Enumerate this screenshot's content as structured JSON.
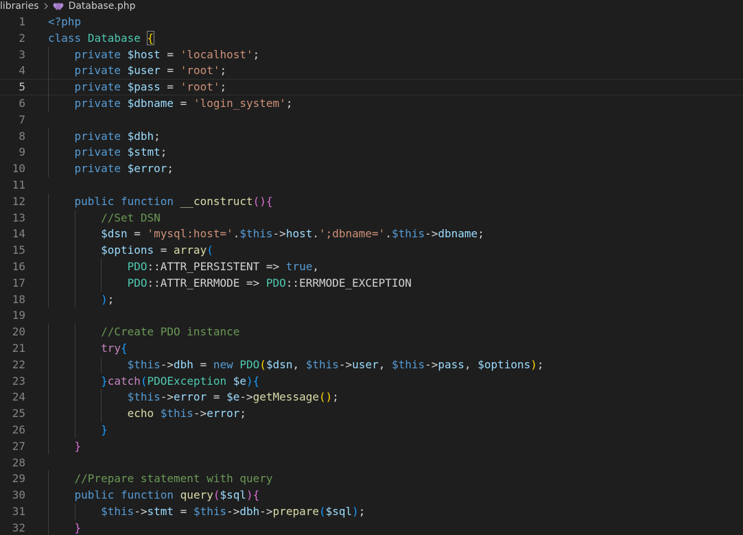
{
  "breadcrumb": {
    "folder": "libraries",
    "file": "Database.php",
    "file_icon": "php-elephant-icon",
    "separator_icon": "chevron-right-icon"
  },
  "editor": {
    "current_line": 5,
    "lines": [
      {
        "n": "1",
        "indent": 0,
        "tokens": [
          [
            "tag",
            "<?php"
          ]
        ]
      },
      {
        "n": "2",
        "indent": 0,
        "tokens": [
          [
            "kw",
            "class"
          ],
          [
            "txt",
            " "
          ],
          [
            "cls",
            "Database"
          ],
          [
            "txt",
            " "
          ],
          [
            "b1hl",
            "{"
          ]
        ]
      },
      {
        "n": "3",
        "indent": 1,
        "tokens": [
          [
            "kw",
            "private"
          ],
          [
            "txt",
            " "
          ],
          [
            "var",
            "$host"
          ],
          [
            "txt",
            " = "
          ],
          [
            "str",
            "'localhost'"
          ],
          [
            "txt",
            ";"
          ]
        ]
      },
      {
        "n": "4",
        "indent": 1,
        "tokens": [
          [
            "kw",
            "private"
          ],
          [
            "txt",
            " "
          ],
          [
            "var",
            "$user"
          ],
          [
            "txt",
            " = "
          ],
          [
            "str",
            "'root'"
          ],
          [
            "txt",
            ";"
          ]
        ]
      },
      {
        "n": "5",
        "indent": 1,
        "tokens": [
          [
            "kw",
            "private"
          ],
          [
            "txt",
            " "
          ],
          [
            "var",
            "$pass"
          ],
          [
            "txt",
            " = "
          ],
          [
            "str",
            "'root'"
          ],
          [
            "txt",
            ";"
          ]
        ]
      },
      {
        "n": "6",
        "indent": 1,
        "tokens": [
          [
            "kw",
            "private"
          ],
          [
            "txt",
            " "
          ],
          [
            "var",
            "$dbname"
          ],
          [
            "txt",
            " = "
          ],
          [
            "str",
            "'login_system'"
          ],
          [
            "txt",
            ";"
          ]
        ]
      },
      {
        "n": "7",
        "indent": 0,
        "tokens": []
      },
      {
        "n": "8",
        "indent": 1,
        "tokens": [
          [
            "kw",
            "private"
          ],
          [
            "txt",
            " "
          ],
          [
            "var",
            "$dbh"
          ],
          [
            "txt",
            ";"
          ]
        ]
      },
      {
        "n": "9",
        "indent": 1,
        "tokens": [
          [
            "kw",
            "private"
          ],
          [
            "txt",
            " "
          ],
          [
            "var",
            "$stmt"
          ],
          [
            "txt",
            ";"
          ]
        ]
      },
      {
        "n": "10",
        "indent": 1,
        "tokens": [
          [
            "kw",
            "private"
          ],
          [
            "txt",
            " "
          ],
          [
            "var",
            "$error"
          ],
          [
            "txt",
            ";"
          ]
        ]
      },
      {
        "n": "11",
        "indent": 0,
        "tokens": []
      },
      {
        "n": "12",
        "indent": 1,
        "tokens": [
          [
            "kw",
            "public"
          ],
          [
            "txt",
            " "
          ],
          [
            "kw",
            "function"
          ],
          [
            "txt",
            " "
          ],
          [
            "fn",
            "__construct"
          ],
          [
            "b2",
            "()"
          ],
          [
            "b2",
            "{"
          ]
        ]
      },
      {
        "n": "13",
        "indent": 2,
        "tokens": [
          [
            "com",
            "//Set DSN"
          ]
        ]
      },
      {
        "n": "14",
        "indent": 2,
        "tokens": [
          [
            "var",
            "$dsn"
          ],
          [
            "txt",
            " = "
          ],
          [
            "str",
            "'mysql:host='"
          ],
          [
            "txt",
            "."
          ],
          [
            "kw",
            "$this"
          ],
          [
            "txt",
            "->"
          ],
          [
            "var",
            "host"
          ],
          [
            "txt",
            "."
          ],
          [
            "str",
            "';dbname='"
          ],
          [
            "txt",
            "."
          ],
          [
            "kw",
            "$this"
          ],
          [
            "txt",
            "->"
          ],
          [
            "var",
            "dbname"
          ],
          [
            "txt",
            ";"
          ]
        ]
      },
      {
        "n": "15",
        "indent": 2,
        "tokens": [
          [
            "var",
            "$options"
          ],
          [
            "txt",
            " = "
          ],
          [
            "fn",
            "array"
          ],
          [
            "b3",
            "("
          ]
        ]
      },
      {
        "n": "16",
        "indent": 3,
        "tokens": [
          [
            "cls",
            "PDO"
          ],
          [
            "txt",
            "::ATTR_PERSISTENT => "
          ],
          [
            "kw",
            "true"
          ],
          [
            "txt",
            ","
          ]
        ]
      },
      {
        "n": "17",
        "indent": 3,
        "tokens": [
          [
            "cls",
            "PDO"
          ],
          [
            "txt",
            "::ATTR_ERRMODE => "
          ],
          [
            "cls",
            "PDO"
          ],
          [
            "txt",
            "::ERRMODE_EXCEPTION"
          ]
        ]
      },
      {
        "n": "18",
        "indent": 2,
        "tokens": [
          [
            "b3",
            ")"
          ],
          [
            "txt",
            ";"
          ]
        ]
      },
      {
        "n": "19",
        "indent": 0,
        "tokens": []
      },
      {
        "n": "20",
        "indent": 2,
        "tokens": [
          [
            "com",
            "//Create PDO instance"
          ]
        ]
      },
      {
        "n": "21",
        "indent": 2,
        "tokens": [
          [
            "ctl",
            "try"
          ],
          [
            "b3",
            "{"
          ]
        ]
      },
      {
        "n": "22",
        "indent": 3,
        "tokens": [
          [
            "kw",
            "$this"
          ],
          [
            "txt",
            "->"
          ],
          [
            "var",
            "dbh"
          ],
          [
            "txt",
            " = "
          ],
          [
            "kw",
            "new"
          ],
          [
            "txt",
            " "
          ],
          [
            "cls",
            "PDO"
          ],
          [
            "b1",
            "("
          ],
          [
            "var",
            "$dsn"
          ],
          [
            "txt",
            ", "
          ],
          [
            "kw",
            "$this"
          ],
          [
            "txt",
            "->"
          ],
          [
            "var",
            "user"
          ],
          [
            "txt",
            ", "
          ],
          [
            "kw",
            "$this"
          ],
          [
            "txt",
            "->"
          ],
          [
            "var",
            "pass"
          ],
          [
            "txt",
            ", "
          ],
          [
            "var",
            "$options"
          ],
          [
            "b1",
            ")"
          ],
          [
            "txt",
            ";"
          ]
        ]
      },
      {
        "n": "23",
        "indent": 2,
        "tokens": [
          [
            "b3",
            "}"
          ],
          [
            "ctl",
            "catch"
          ],
          [
            "b3",
            "("
          ],
          [
            "cls",
            "PDOException"
          ],
          [
            "txt",
            " "
          ],
          [
            "var",
            "$e"
          ],
          [
            "b3",
            ")"
          ],
          [
            "b3",
            "{"
          ]
        ]
      },
      {
        "n": "24",
        "indent": 3,
        "tokens": [
          [
            "kw",
            "$this"
          ],
          [
            "txt",
            "->"
          ],
          [
            "var",
            "error"
          ],
          [
            "txt",
            " = "
          ],
          [
            "var",
            "$e"
          ],
          [
            "txt",
            "->"
          ],
          [
            "fn",
            "getMessage"
          ],
          [
            "b1",
            "()"
          ],
          [
            "txt",
            ";"
          ]
        ]
      },
      {
        "n": "25",
        "indent": 3,
        "tokens": [
          [
            "fn",
            "echo"
          ],
          [
            "txt",
            " "
          ],
          [
            "kw",
            "$this"
          ],
          [
            "txt",
            "->"
          ],
          [
            "var",
            "error"
          ],
          [
            "txt",
            ";"
          ]
        ]
      },
      {
        "n": "26",
        "indent": 2,
        "tokens": [
          [
            "b3",
            "}"
          ]
        ]
      },
      {
        "n": "27",
        "indent": 1,
        "tokens": [
          [
            "b2",
            "}"
          ]
        ]
      },
      {
        "n": "28",
        "indent": 0,
        "tokens": []
      },
      {
        "n": "29",
        "indent": 1,
        "tokens": [
          [
            "com",
            "//Prepare statement with query"
          ]
        ]
      },
      {
        "n": "30",
        "indent": 1,
        "tokens": [
          [
            "kw",
            "public"
          ],
          [
            "txt",
            " "
          ],
          [
            "kw",
            "function"
          ],
          [
            "txt",
            " "
          ],
          [
            "fn",
            "query"
          ],
          [
            "b2",
            "("
          ],
          [
            "var",
            "$sql"
          ],
          [
            "b2",
            ")"
          ],
          [
            "b2",
            "{"
          ]
        ]
      },
      {
        "n": "31",
        "indent": 2,
        "tokens": [
          [
            "kw",
            "$this"
          ],
          [
            "txt",
            "->"
          ],
          [
            "var",
            "stmt"
          ],
          [
            "txt",
            " = "
          ],
          [
            "kw",
            "$this"
          ],
          [
            "txt",
            "->"
          ],
          [
            "var",
            "dbh"
          ],
          [
            "txt",
            "->"
          ],
          [
            "fn",
            "prepare"
          ],
          [
            "b3",
            "("
          ],
          [
            "var",
            "$sql"
          ],
          [
            "b3",
            ")"
          ],
          [
            "txt",
            ";"
          ]
        ]
      },
      {
        "n": "32",
        "indent": 1,
        "tokens": [
          [
            "b2",
            "}"
          ]
        ]
      }
    ]
  }
}
